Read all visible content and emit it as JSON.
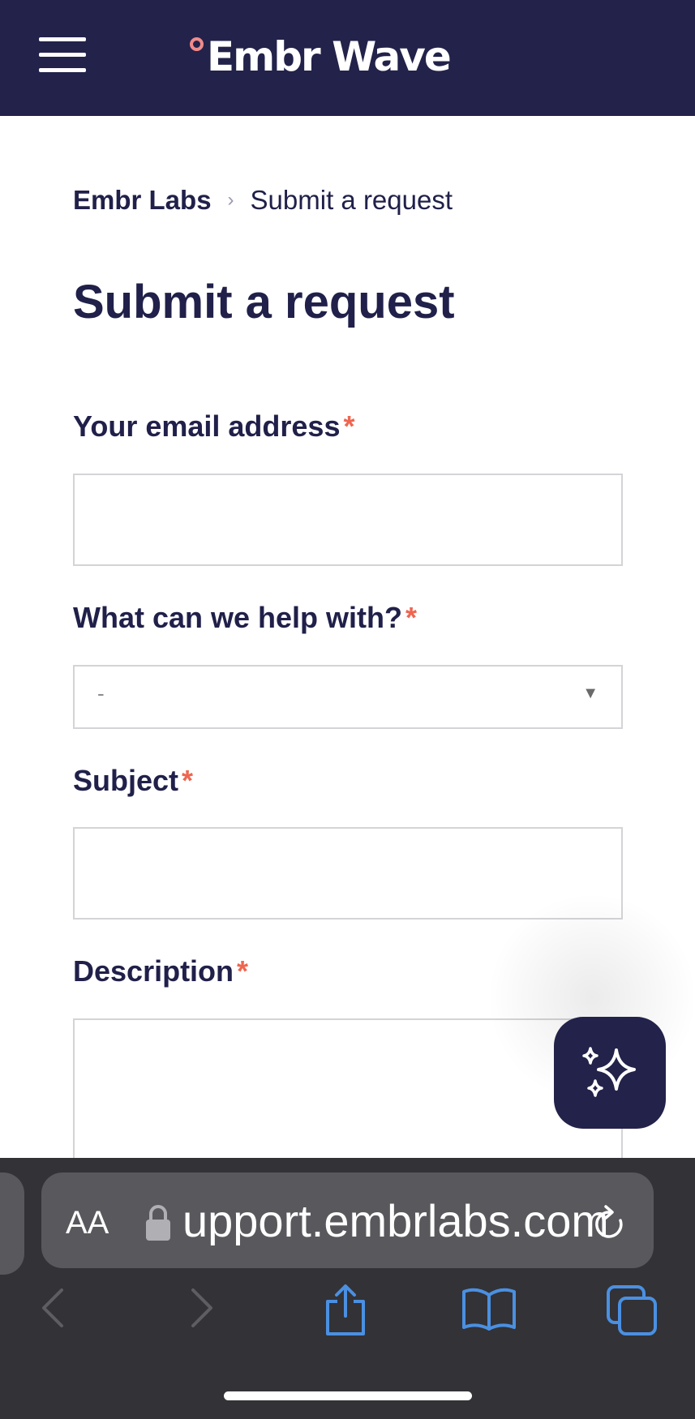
{
  "header": {
    "brand": "Embr Wave",
    "menu_icon": "hamburger-menu-icon"
  },
  "breadcrumb": {
    "root": "Embr Labs",
    "separator": "›",
    "current": "Submit a request"
  },
  "page": {
    "title": "Submit a request"
  },
  "form": {
    "email_label": "Your email address",
    "help_label": "What can we help with?",
    "help_value": "-",
    "subject_label": "Subject",
    "description_label": "Description",
    "required_marker": "*"
  },
  "assistant": {
    "icon": "sparkles-icon"
  },
  "browser": {
    "text_size_label": "AA",
    "url": "support.embrlabs.com",
    "icons": [
      "lock-icon",
      "reload-icon",
      "back-icon",
      "forward-icon",
      "share-icon",
      "bookmarks-icon",
      "tabs-icon"
    ]
  },
  "colors": {
    "navy": "#22224a",
    "required_red": "#ee6650",
    "browser_blue": "#4a90e2"
  }
}
